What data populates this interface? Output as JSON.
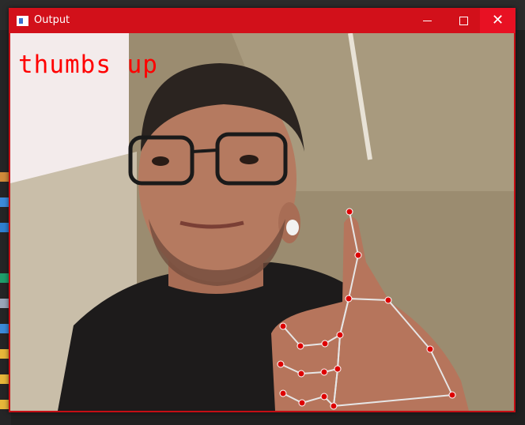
{
  "window": {
    "title": "Output",
    "accent_color": "#d2101a",
    "close_hover_color": "#e81123",
    "controls": [
      "minimize-icon",
      "maximize-icon",
      "close-icon"
    ]
  },
  "video": {
    "overlay_label": "thumbs up",
    "overlay_color": "#ff0000",
    "landmark_color": "#dd0000",
    "connection_color": "#e6e6e6"
  }
}
